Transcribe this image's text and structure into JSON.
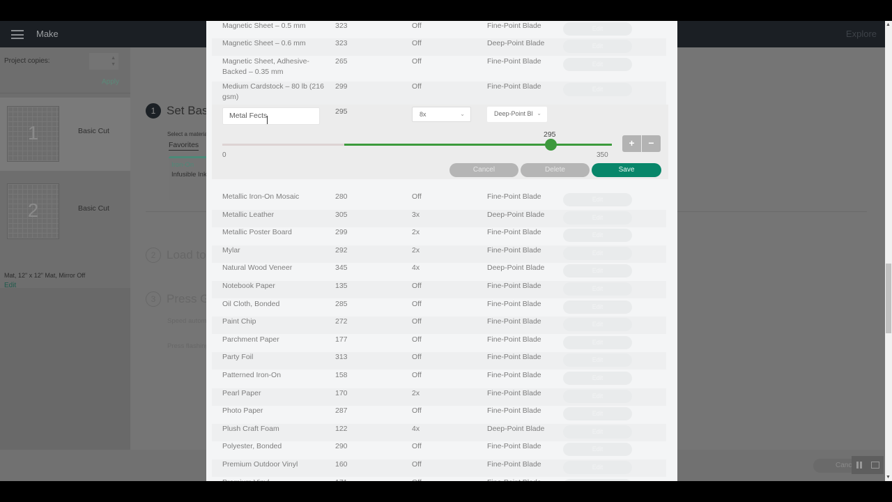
{
  "app": {
    "title": "Make",
    "explore_label": "Explore"
  },
  "left_panel": {
    "project_copies_label": "Project copies:",
    "apply_label": "Apply",
    "mats": [
      {
        "number": "1",
        "label": "Basic Cut"
      },
      {
        "number": "2",
        "label": "Basic Cut"
      }
    ],
    "mat_info": "Mat, 12\" x 12\" Mat, Mirror Off",
    "edit_label": "Edit"
  },
  "steps": {
    "step1": {
      "number": "1",
      "title": "Set Base Material"
    },
    "select_material_label": "Select a material",
    "favorites_tab": "Favorites",
    "favorite_card": {
      "category": "Iron-On",
      "name": "Infusible Ink Transfer Sheet"
    },
    "step2": {
      "number": "2",
      "title": "Load tools and mat"
    },
    "step3": {
      "number": "3",
      "title": "Press Go"
    },
    "speed_text": "Speed automatically set",
    "press_text": "Press flashing Go button"
  },
  "footer": {
    "cancel_label": "Cancel"
  },
  "materials_modal": {
    "rows_top": [
      {
        "name": "Magnetic Sheet – 0.5 mm",
        "pressure": "323",
        "multi_cut": "Off",
        "blade": "Fine-Point Blade",
        "edit": "Edit"
      },
      {
        "name": "Magnetic Sheet – 0.6 mm",
        "pressure": "323",
        "multi_cut": "Off",
        "blade": "Deep-Point Blade",
        "edit": "Edit"
      },
      {
        "name": "Magnetic Sheet, Adhesive-Backed – 0.35 mm",
        "pressure": "265",
        "multi_cut": "Off",
        "blade": "Fine-Point Blade",
        "edit": "Edit"
      },
      {
        "name": "Medium Cardstock – 80 lb (216 gsm)",
        "pressure": "299",
        "multi_cut": "Off",
        "blade": "Fine-Point Blade",
        "edit": "Edit"
      }
    ],
    "editing_row": {
      "name_value": "Metal Fects",
      "pressure": "295",
      "multi_cut_selected": "8x",
      "blade_selected": "Deep-Point Bl",
      "slider": {
        "value": 295,
        "min": 0,
        "max": 350,
        "min_label": "0",
        "max_label": "350",
        "value_label": "295",
        "lower_bound_hint": 100
      },
      "plus_label": "+",
      "minus_label": "−",
      "cancel_label": "Cancel",
      "delete_label": "Delete",
      "save_label": "Save"
    },
    "rows_bottom": [
      {
        "name": "Metallic Iron-On Mosaic",
        "pressure": "280",
        "multi_cut": "Off",
        "blade": "Fine-Point Blade",
        "edit": "Edit"
      },
      {
        "name": "Metallic Leather",
        "pressure": "305",
        "multi_cut": "3x",
        "blade": "Deep-Point Blade",
        "edit": "Edit"
      },
      {
        "name": "Metallic Poster Board",
        "pressure": "299",
        "multi_cut": "2x",
        "blade": "Fine-Point Blade",
        "edit": "Edit"
      },
      {
        "name": "Mylar",
        "pressure": "292",
        "multi_cut": "2x",
        "blade": "Fine-Point Blade",
        "edit": "Edit"
      },
      {
        "name": "Natural Wood Veneer",
        "pressure": "345",
        "multi_cut": "4x",
        "blade": "Deep-Point Blade",
        "edit": "Edit"
      },
      {
        "name": "Notebook Paper",
        "pressure": "135",
        "multi_cut": "Off",
        "blade": "Fine-Point Blade",
        "edit": "Edit"
      },
      {
        "name": "Oil Cloth, Bonded",
        "pressure": "285",
        "multi_cut": "Off",
        "blade": "Fine-Point Blade",
        "edit": "Edit"
      },
      {
        "name": "Paint Chip",
        "pressure": "272",
        "multi_cut": "Off",
        "blade": "Fine-Point Blade",
        "edit": "Edit"
      },
      {
        "name": "Parchment Paper",
        "pressure": "177",
        "multi_cut": "Off",
        "blade": "Fine-Point Blade",
        "edit": "Edit"
      },
      {
        "name": "Party Foil",
        "pressure": "313",
        "multi_cut": "Off",
        "blade": "Fine-Point Blade",
        "edit": "Edit"
      },
      {
        "name": "Patterned Iron-On",
        "pressure": "158",
        "multi_cut": "Off",
        "blade": "Fine-Point Blade",
        "edit": "Edit"
      },
      {
        "name": "Pearl Paper",
        "pressure": "170",
        "multi_cut": "2x",
        "blade": "Fine-Point Blade",
        "edit": "Edit"
      },
      {
        "name": "Photo Paper",
        "pressure": "287",
        "multi_cut": "Off",
        "blade": "Fine-Point Blade",
        "edit": "Edit"
      },
      {
        "name": "Plush Craft Foam",
        "pressure": "122",
        "multi_cut": "4x",
        "blade": "Deep-Point Blade",
        "edit": "Edit"
      },
      {
        "name": "Polyester, Bonded",
        "pressure": "290",
        "multi_cut": "Off",
        "blade": "Fine-Point Blade",
        "edit": "Edit"
      },
      {
        "name": "Premium Outdoor Vinyl",
        "pressure": "160",
        "multi_cut": "Off",
        "blade": "Fine-Point Blade",
        "edit": "Edit"
      },
      {
        "name": "Premium Vinyl",
        "pressure": "171",
        "multi_cut": "Off",
        "blade": "Fine-Point Blade",
        "edit": "Edit"
      }
    ]
  },
  "colors": {
    "accent_green": "#08866a",
    "slider_green": "#3c9a3c"
  }
}
